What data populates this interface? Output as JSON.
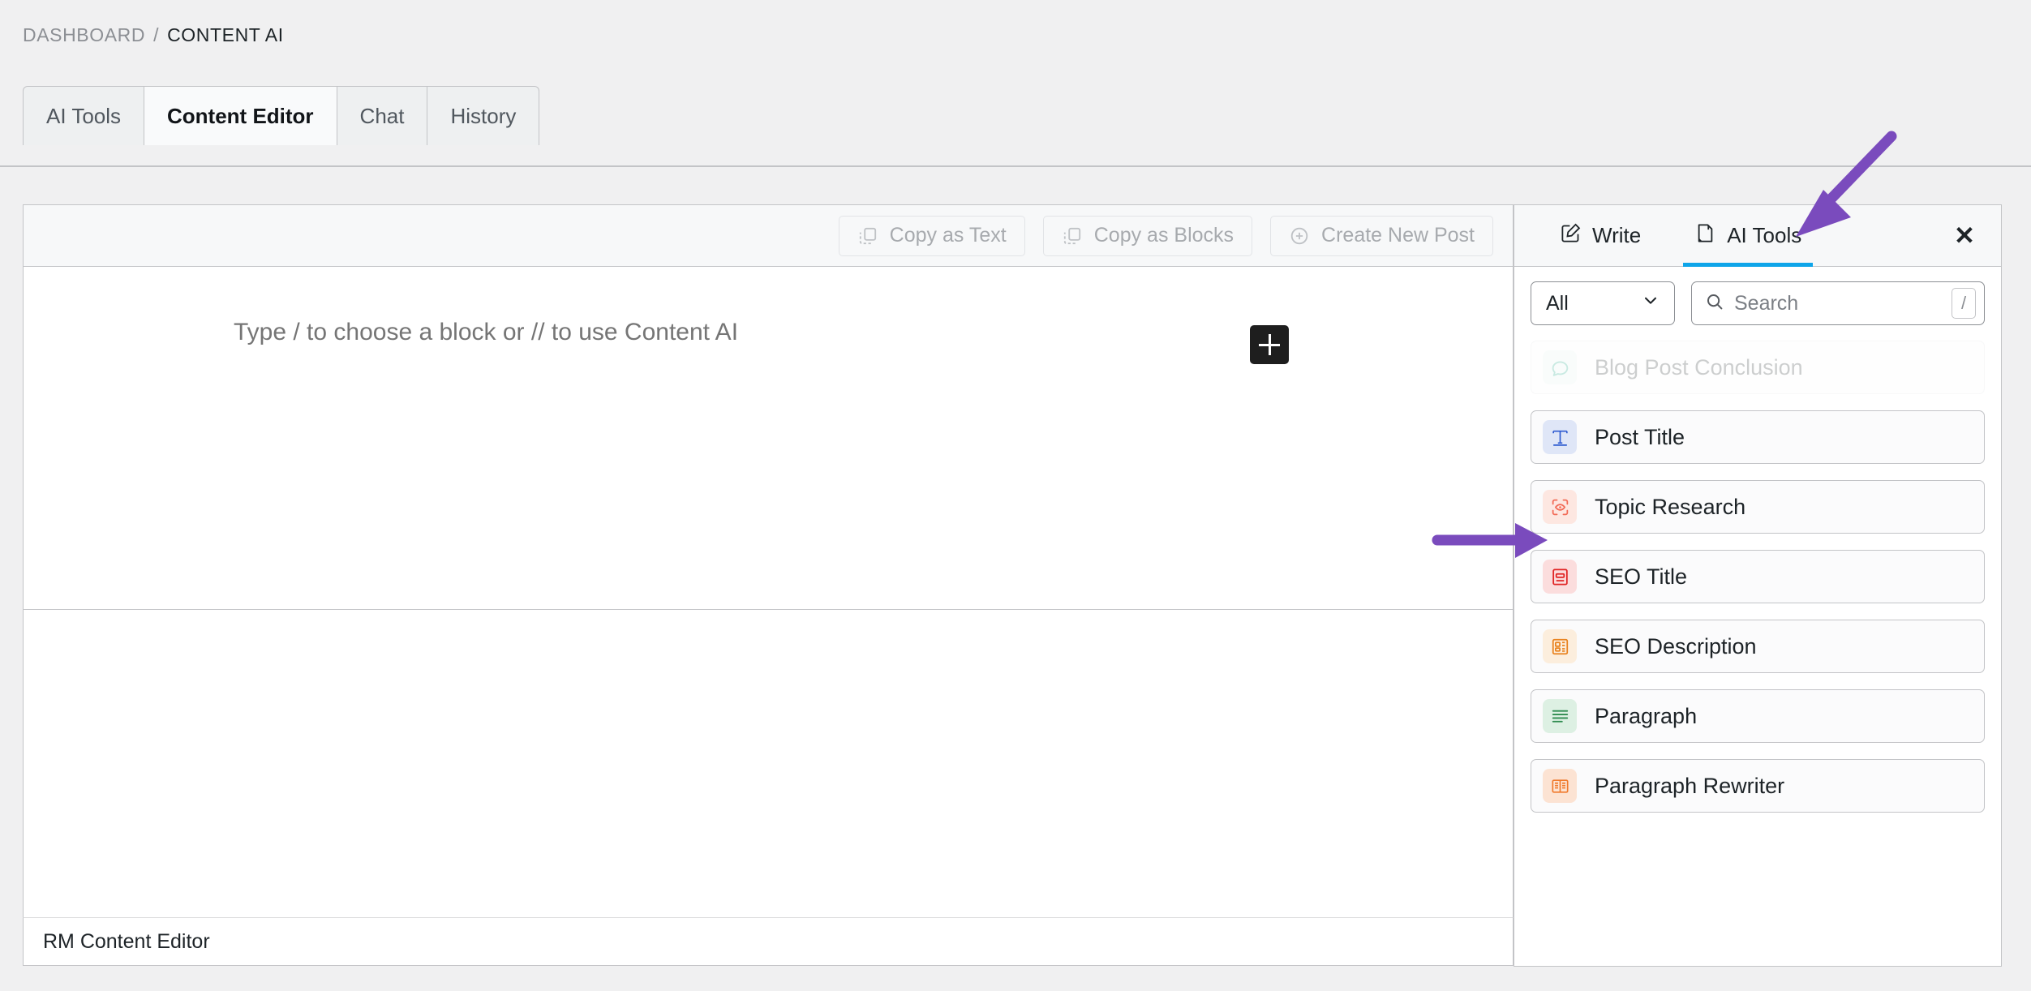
{
  "breadcrumb": {
    "root": "DASHBOARD",
    "separator": "/",
    "current": "CONTENT AI"
  },
  "tabs": [
    {
      "label": "AI Tools",
      "active": false
    },
    {
      "label": "Content Editor",
      "active": true
    },
    {
      "label": "Chat",
      "active": false
    },
    {
      "label": "History",
      "active": false
    }
  ],
  "editor": {
    "toolbar": [
      {
        "label": "Copy as Text",
        "icon": "copy-icon"
      },
      {
        "label": "Copy as Blocks",
        "icon": "copy-icon"
      },
      {
        "label": "Create New Post",
        "icon": "plus-circle-icon"
      }
    ],
    "placeholder": "Type / to choose a block or // to use Content AI",
    "inserter_icon": "plus-icon",
    "status_label": "RM Content Editor"
  },
  "ai_panel": {
    "tabs": [
      {
        "label": "Write",
        "icon": "pencil-square-icon",
        "active": false
      },
      {
        "label": "AI Tools",
        "icon": "document-pen-icon",
        "active": true
      }
    ],
    "close_icon": "close-icon",
    "filter": {
      "selected": "All",
      "chevron_icon": "chevron-down-icon"
    },
    "search": {
      "placeholder": "Search",
      "icon": "search-icon",
      "shortcut": "/"
    },
    "tools": [
      {
        "label": "Blog Post Conclusion",
        "icon": "chat-bubble-icon",
        "icon_color": "#10a37f",
        "icon_bg": "#e8f6f1",
        "ghost": true
      },
      {
        "label": "Post Title",
        "icon": "text-title-icon",
        "icon_color": "#2f5bd0",
        "icon_bg": "#dfe6f7",
        "ghost": false
      },
      {
        "label": "Topic Research",
        "icon": "scan-eye-icon",
        "icon_color": "#f26b57",
        "icon_bg": "#fde7e1",
        "ghost": false
      },
      {
        "label": "SEO Title",
        "icon": "seo-title-icon",
        "icon_color": "#e02424",
        "icon_bg": "#fbdddd",
        "ghost": false
      },
      {
        "label": "SEO Description",
        "icon": "seo-description-icon",
        "icon_color": "#e8821e",
        "icon_bg": "#fceedd",
        "ghost": false
      },
      {
        "label": "Paragraph",
        "icon": "paragraph-lines-icon",
        "icon_color": "#2e8b4f",
        "icon_bg": "#ddf0e3",
        "ghost": false
      },
      {
        "label": "Paragraph Rewriter",
        "icon": "open-book-icon",
        "icon_color": "#f0792b",
        "icon_bg": "#fce3d3",
        "ghost": false
      }
    ]
  },
  "annotations": {
    "accent_color": "#7a4bbd",
    "arrows": [
      {
        "name": "arrow-to-ai-tools-tab"
      },
      {
        "name": "arrow-to-topic-research"
      }
    ]
  },
  "colors": {
    "page_bg": "#f0f0f1",
    "panel_border": "#c3c4c7",
    "active_tab_underline": "#0ea5e9",
    "annotation_purple": "#7a4bbd"
  }
}
